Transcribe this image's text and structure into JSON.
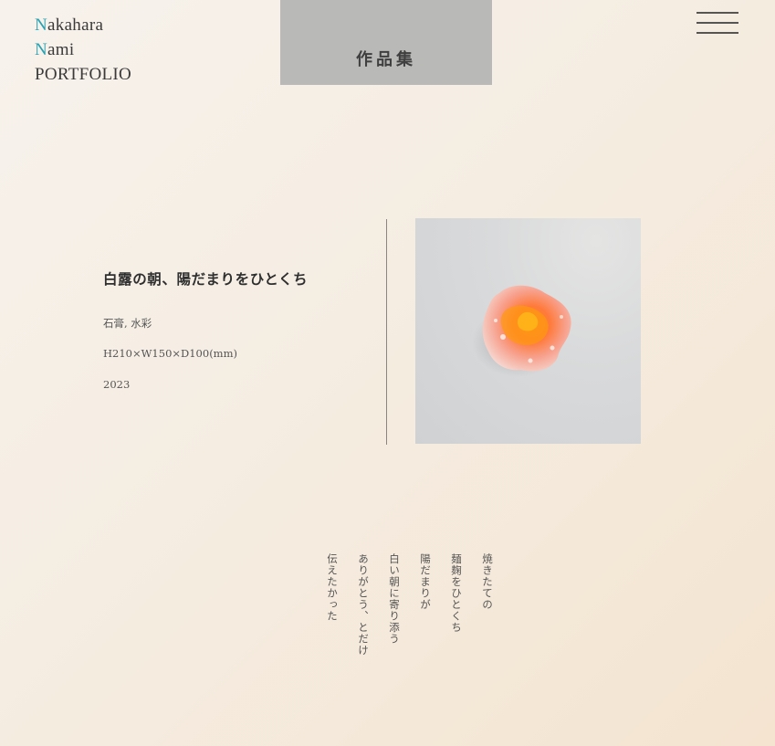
{
  "header": {
    "logo": {
      "line1_initial": "N",
      "line1_rest": "akahara",
      "line2_initial": "N",
      "line2_rest": "ami",
      "line3": "PORTFOLIO"
    },
    "page_tab_label": "作品集",
    "menu_icon": "hamburger-menu-icon"
  },
  "work": {
    "title": "白露の朝、陽だまりをひとくち",
    "material": "石膏, 水彩",
    "size": "H210×W150×D100(mm)",
    "year": "2023"
  },
  "poem": {
    "lines": [
      "焼きたての",
      "麺麹をひとくち",
      "陽だまりが",
      "白い朝に寄り添う",
      "ありがとう、とだけ",
      "伝えたかった"
    ]
  },
  "colors": {
    "logo_accent": "#2aa0b0",
    "tab_background": "#b9b9b7",
    "page_background": "#f5ede2"
  }
}
